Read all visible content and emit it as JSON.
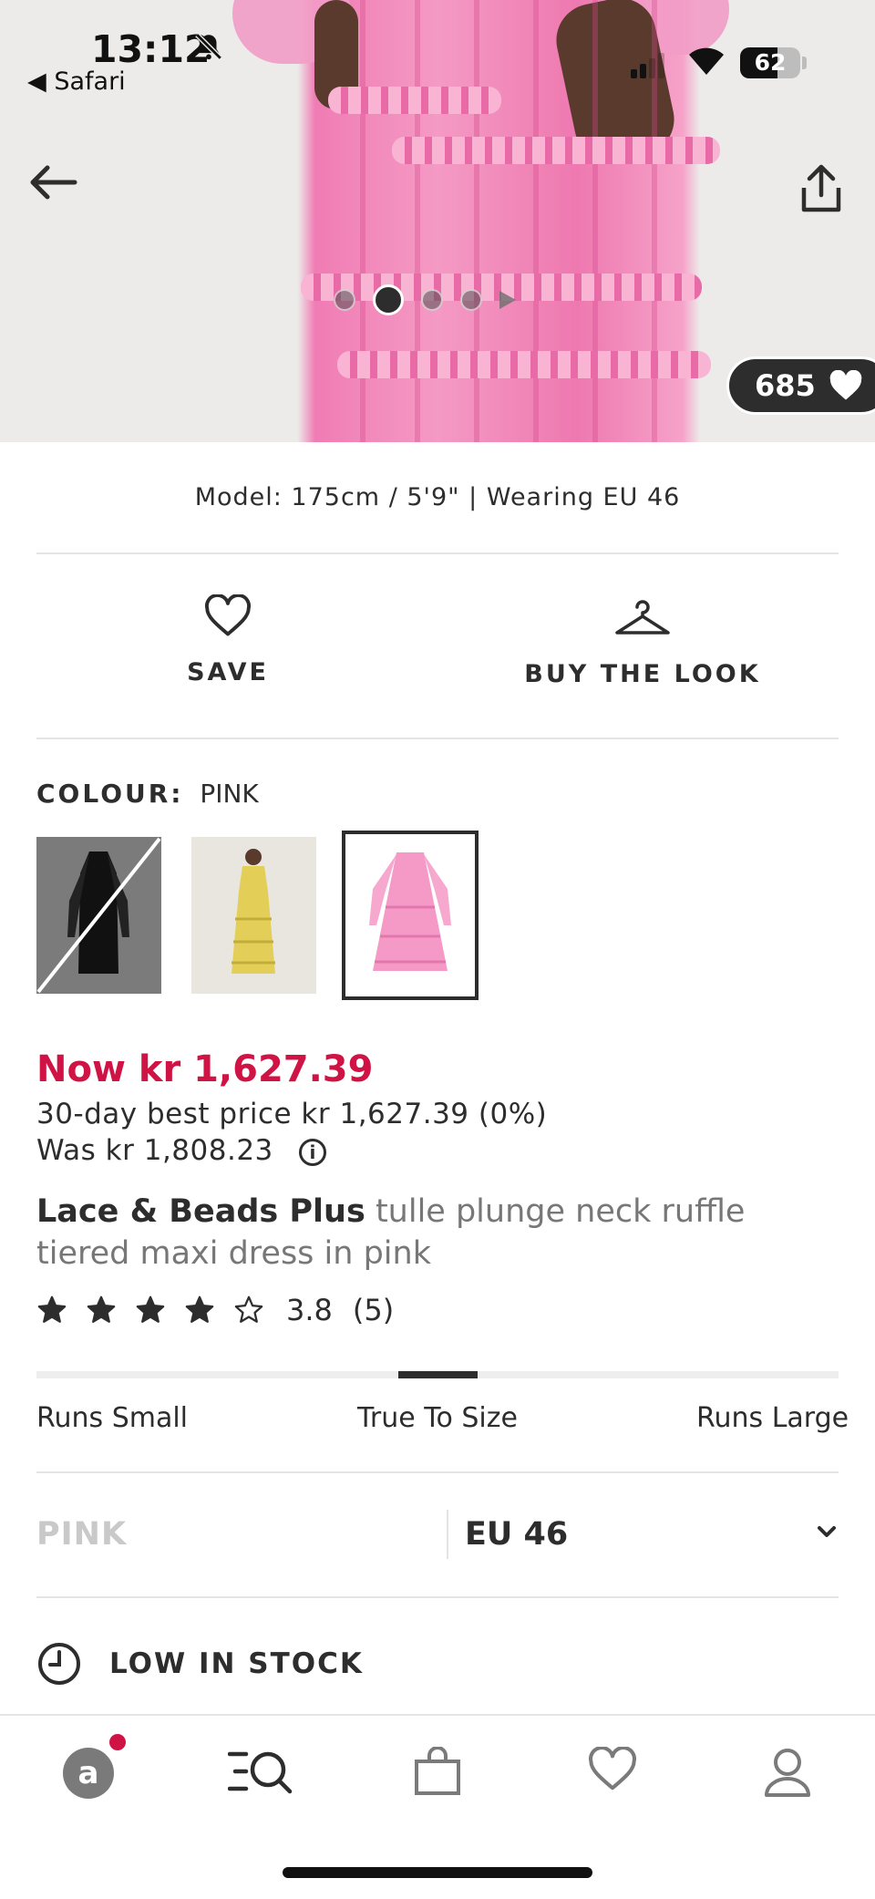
{
  "status_bar": {
    "time": "13:12",
    "back_app": "◀ Safari",
    "battery": "62"
  },
  "product_gallery": {
    "image_count": 5,
    "active_index": 1,
    "likes": "685"
  },
  "model_info": "Model: 175cm / 5'9\" | Wearing EU 46",
  "actions": {
    "save_label": "SAVE",
    "buy_look_label": "BUY THE LOOK"
  },
  "colour": {
    "label": "COLOUR:",
    "value": "PINK",
    "swatches": [
      {
        "name": "black",
        "available": false
      },
      {
        "name": "yellow",
        "available": true
      },
      {
        "name": "pink",
        "available": true,
        "selected": true
      }
    ]
  },
  "price": {
    "now": "Now kr 1,627.39",
    "best_price": "30-day best price kr 1,627.39 (0%)",
    "was": "Was kr 1,808.23",
    "accent_color": "#d01345"
  },
  "product": {
    "brand": "Lace & Beads Plus",
    "name": "tulle plunge neck ruffle tiered maxi dress in pink"
  },
  "rating": {
    "score_text": "3.8",
    "count_text": "(5)",
    "stars_filled": 4,
    "stars_total": 5
  },
  "fit": {
    "small": "Runs Small",
    "true": "True To Size",
    "large": "Runs Large",
    "position": 0.5
  },
  "selection": {
    "colour": "PINK",
    "size": "EU 46"
  },
  "stock": {
    "label": "LOW IN STOCK"
  },
  "tab_bar": {
    "items": [
      "home-icon",
      "search-icon",
      "bag-icon",
      "saved-icon",
      "account-icon"
    ]
  }
}
